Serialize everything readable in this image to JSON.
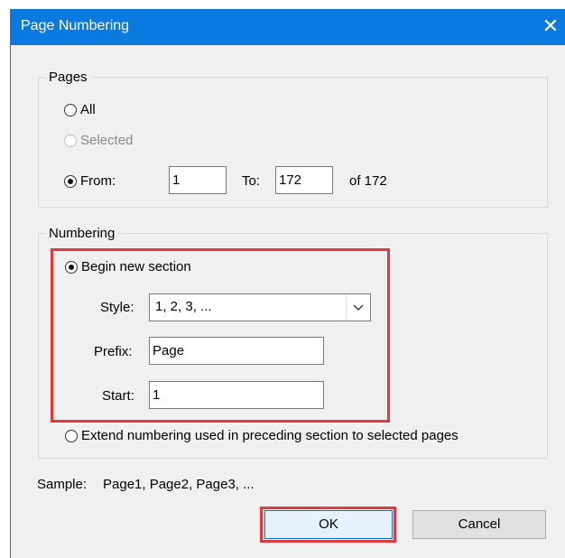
{
  "window": {
    "title": "Page Numbering",
    "close_glyph": "✕"
  },
  "pages": {
    "legend": "Pages",
    "all_label": "All",
    "selected_label": "Selected",
    "from_label": "From:",
    "from_value": "1",
    "to_label": "To:",
    "to_value": "172",
    "of_label": "of 172",
    "selected_option": "From"
  },
  "numbering": {
    "legend": "Numbering",
    "begin_label": "Begin new section",
    "style_label": "Style:",
    "style_value": "1, 2, 3, ...",
    "prefix_label": "Prefix:",
    "prefix_value": "Page",
    "start_label": "Start:",
    "start_value": "1",
    "extend_label": "Extend numbering used in preceding section to selected pages",
    "selected_option": "Begin new section"
  },
  "sample": {
    "label": "Sample:",
    "value": "Page1, Page2, Page3, ..."
  },
  "buttons": {
    "ok": "OK",
    "cancel": "Cancel"
  },
  "colors": {
    "titlebar": "#0a7ae0",
    "highlight": "#e0393e",
    "dialog_bg": "#f0f0f0"
  },
  "icons": {
    "close": "close-icon",
    "dropdown": "chevron-down-icon"
  }
}
